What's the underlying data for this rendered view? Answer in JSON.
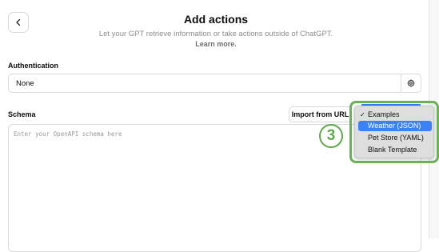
{
  "header": {
    "title": "Add actions",
    "subtitle": "Let your GPT retrieve information or take actions outside of ChatGPT.",
    "learn_more": "Learn more."
  },
  "authentication": {
    "label": "Authentication",
    "value": "None",
    "settings_icon": "gear-icon"
  },
  "schema": {
    "label": "Schema",
    "import_button": "Import from URL",
    "placeholder": "Enter your OpenAPI schema here"
  },
  "examples_menu": {
    "items": [
      {
        "label": "Examples",
        "checked": true,
        "selected": false
      },
      {
        "label": "Weather (JSON)",
        "checked": false,
        "selected": true
      },
      {
        "label": "Pet Store (YAML)",
        "checked": false,
        "selected": false
      },
      {
        "label": "Blank Template",
        "checked": false,
        "selected": false
      }
    ],
    "check_mark": "✓",
    "highlight_color": "#6db05a",
    "selected_color": "#3b82f6"
  },
  "annotation": {
    "step_number": "3"
  }
}
